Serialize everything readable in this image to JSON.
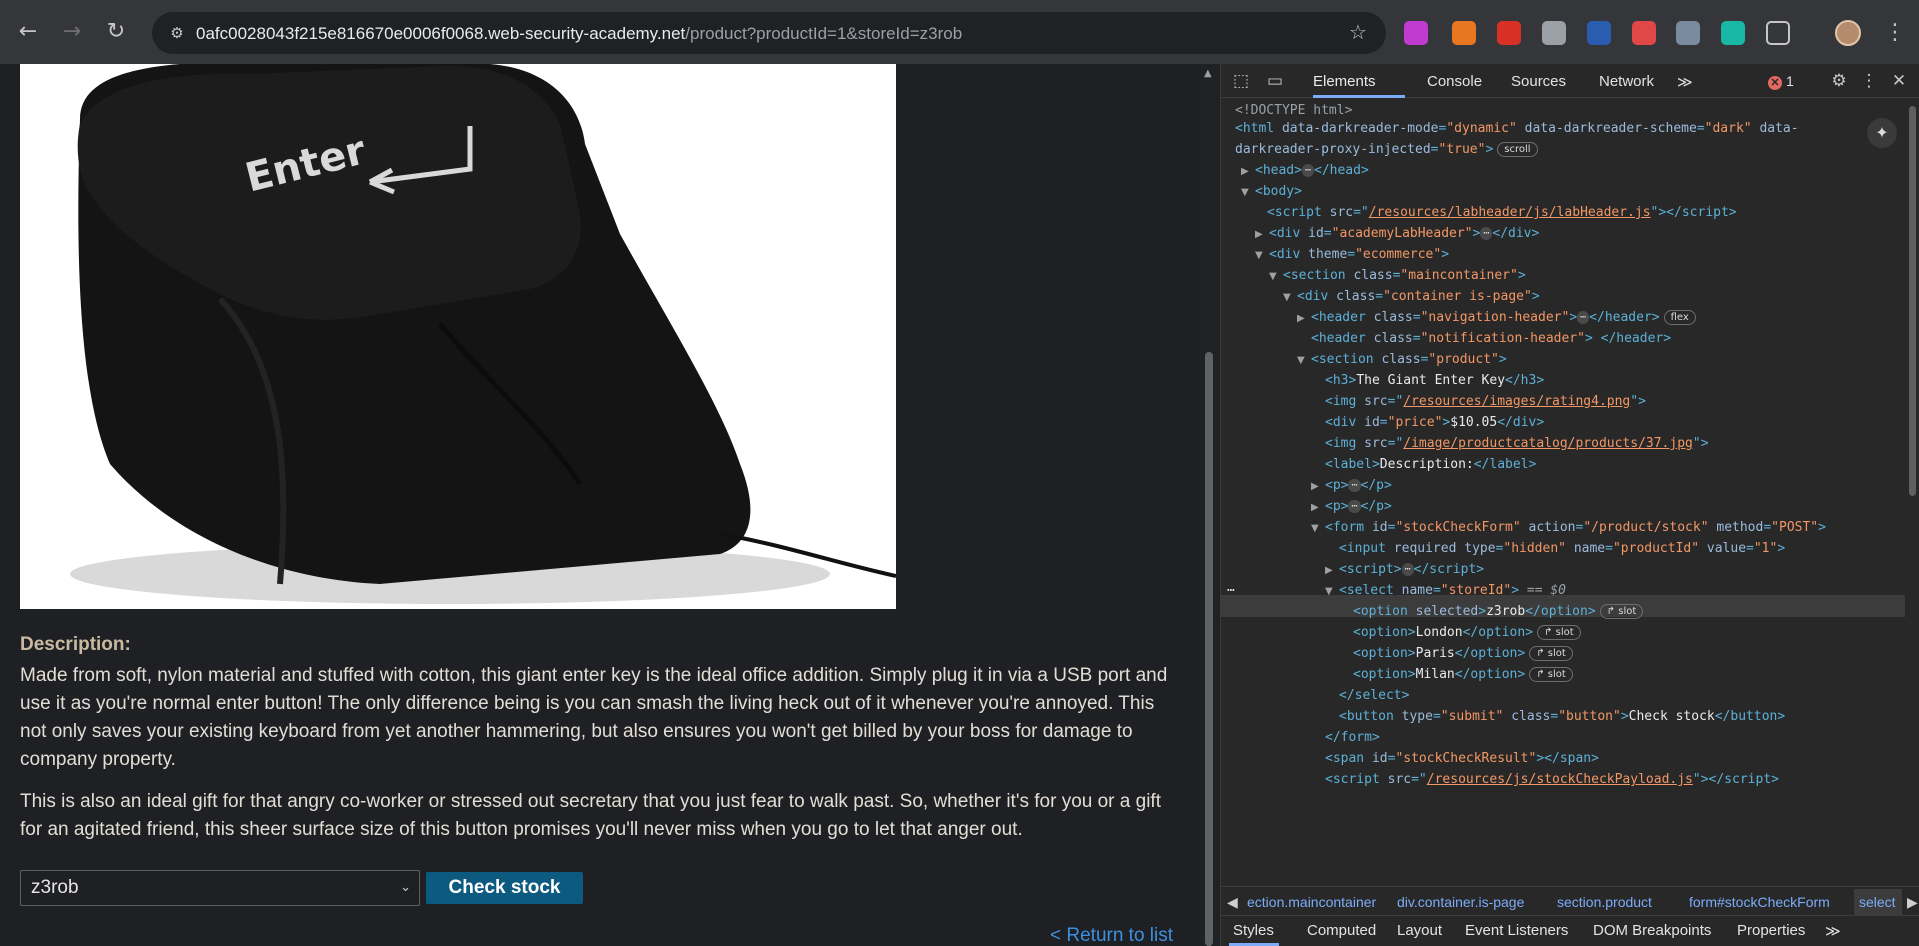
{
  "browser": {
    "url_domain": "0afc0028043f215e816670e0006f0068.web-security-academy.net",
    "url_path": "/product?productId=1&storeId=z3rob",
    "extensions": [
      {
        "name": "extension-1-icon",
        "color": "#c23bd1"
      },
      {
        "name": "extension-2-icon",
        "color": "#e87722"
      },
      {
        "name": "extension-3-icon",
        "color": "#d93025"
      },
      {
        "name": "extension-4-icon",
        "color": "#9aa0a6"
      },
      {
        "name": "extension-5-icon",
        "color": "#2a5db0"
      },
      {
        "name": "extension-6-icon",
        "color": "#e04848"
      },
      {
        "name": "extension-7-icon",
        "color": "#7a8ba0"
      },
      {
        "name": "extension-8-icon",
        "color": "#19b7a6"
      },
      {
        "name": "extensions-puzzle-icon",
        "color": "#c6c6c6"
      }
    ]
  },
  "page": {
    "description_label": "Description:",
    "description_p1": "Made from soft, nylon material and stuffed with cotton, this giant enter key is the ideal office addition. Simply plug it in via a USB port and use it as you're normal enter button! The only difference being is you can smash the living heck out of it whenever you're annoyed. This not only saves your existing keyboard from yet another hammering, but also ensures you won't get billed by your boss for damage to company property.",
    "description_p2": "This is also an ideal gift for that angry co-worker or stressed out secretary that you just fear to walk past. So, whether it's for you or a gift for an agitated friend, this sheer surface size of this button promises you'll never miss when you go to let that anger out.",
    "product_image_text": "Enter",
    "store_select_value": "z3rob",
    "check_stock_label": "Check stock",
    "return_link": "< Return to list"
  },
  "devtools": {
    "tabs": [
      "Elements",
      "Console",
      "Sources",
      "Network"
    ],
    "more_tabs": "≫",
    "error_count": "1",
    "dom_lines": {
      "doctype": "<!DOCTYPE html>",
      "html_open": "<html",
      "html_attr1_name": "data-darkreader-mode",
      "html_attr1_val": "\"dynamic\"",
      "html_attr2_name": "data-darkreader-scheme",
      "html_attr2_val": "\"dark\"",
      "html_attr3_name": "data-",
      "html_attr3_name_cont": "darkreader-proxy-injected",
      "html_attr3_val": "\"true\"",
      "scroll_pill": "scroll",
      "head": "<head>",
      "head_close": "</head>",
      "body": "<body>",
      "script_src": "/resources/labheader/js/labHeader.js",
      "div_id_val": "\"academyLabHeader\"",
      "div_theme_val": "\"ecommerce\"",
      "section_class_val": "\"maincontainer\"",
      "container_class_val": "\"container is-page\"",
      "nav_header_val": "\"navigation-header\"",
      "flex_pill": "flex",
      "notif_header_val": "\"notification-header\"",
      "section_product_val": "\"product\"",
      "h3_text": "The Giant Enter Key",
      "rating_src": "/resources/images/rating4.png",
      "price_id_val": "\"price\"",
      "price_text": "$10.05",
      "product_img_src": "/image/productcatalog/products/37.jpg",
      "label_text": "Description:",
      "form_id_val": "\"stockCheckForm\"",
      "form_action_val": "\"/product/stock\"",
      "form_method_val": "\"POST\"",
      "input_type_val": "\"hidden\"",
      "input_name_val": "\"productId\"",
      "input_value_val": "\"1\"",
      "select_name_val": "\"storeId\"",
      "select_eq": "== $0",
      "option1": "z3rob",
      "option2": "London",
      "option3": "Paris",
      "option4": "Milan",
      "slot_pill": "slot",
      "button_type_val": "\"submit\"",
      "button_class_val": "\"button\"",
      "button_text": "Check stock",
      "span_id_val": "\"stockCheckResult\"",
      "script2_src": "/resources/js/stockCheckPayload.js"
    },
    "breadcrumbs": [
      "ection.maincontainer",
      "div.container.is-page",
      "section.product",
      "form#stockCheckForm",
      "select"
    ],
    "sub_tabs": [
      "Styles",
      "Computed",
      "Layout",
      "Event Listeners",
      "DOM Breakpoints",
      "Properties"
    ]
  }
}
